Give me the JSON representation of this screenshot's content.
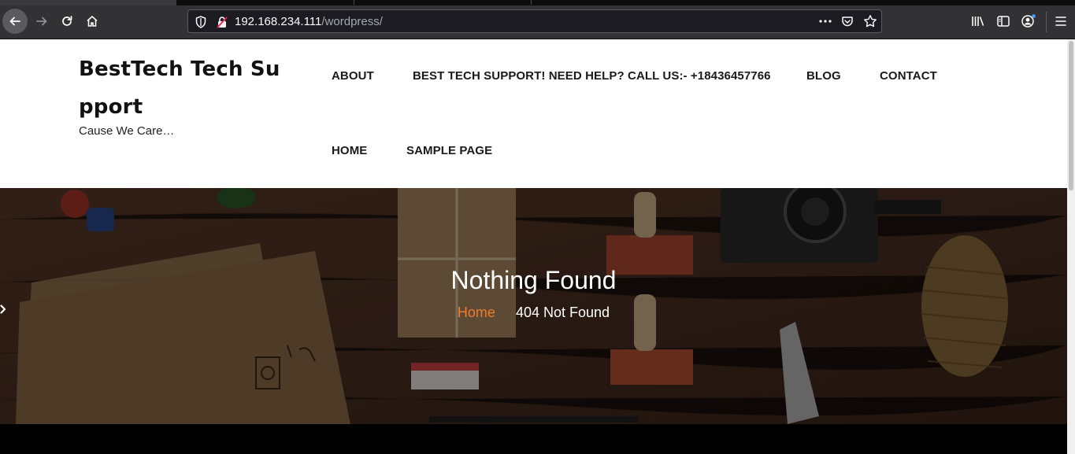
{
  "browser": {
    "url_host": "192.168.234.111",
    "url_path": "/wordpress/"
  },
  "site": {
    "title": "BestTech Tech Support",
    "tagline": "Cause We Care…"
  },
  "menu": {
    "items": [
      {
        "label": "ABOUT"
      },
      {
        "label": "BEST TECH SUPPORT! NEED HELP? CALL US:- +18436457766"
      },
      {
        "label": "BLOG"
      },
      {
        "label": "CONTACT"
      },
      {
        "label": "HOME"
      },
      {
        "label": "SAMPLE PAGE"
      }
    ]
  },
  "hero": {
    "title": "Nothing Found",
    "breadcrumb_home": "Home",
    "breadcrumb_current": "404 Not Found"
  },
  "colors": {
    "accent": "#f07c2c",
    "chrome_toolbar": "#323234",
    "urlbar_bg": "#1c1b22"
  }
}
